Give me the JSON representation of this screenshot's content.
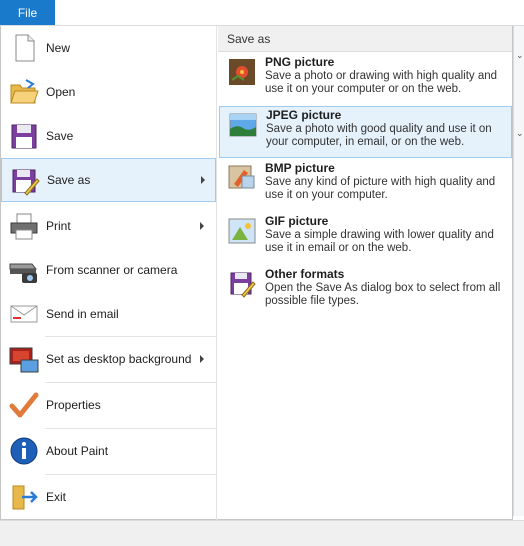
{
  "ribbon": {
    "file_tab": "File"
  },
  "menu": {
    "items": [
      {
        "label": "New"
      },
      {
        "label": "Open"
      },
      {
        "label": "Save"
      },
      {
        "label": "Save as"
      },
      {
        "label": "Print"
      },
      {
        "label": "From scanner or camera"
      },
      {
        "label": "Send in email"
      },
      {
        "label": "Set as desktop background"
      },
      {
        "label": "Properties"
      },
      {
        "label": "About Paint"
      },
      {
        "label": "Exit"
      }
    ]
  },
  "saveas": {
    "header": "Save as",
    "options": [
      {
        "title": "PNG picture",
        "desc": "Save a photo or drawing with high quality and use it on your computer or on the web."
      },
      {
        "title": "JPEG picture",
        "desc": "Save a photo with good quality and use it on your computer, in email, or on the web."
      },
      {
        "title": "BMP picture",
        "desc": "Save any kind of picture with high quality and use it on your computer."
      },
      {
        "title": "GIF picture",
        "desc": "Save a simple drawing with lower quality and use it in email or on the web."
      },
      {
        "title": "Other formats",
        "desc": "Open the Save As dialog box to select from all possible file types."
      }
    ]
  },
  "colors": {
    "accent": "#1979ca",
    "hover": "#e5f1fb",
    "hover_border": "#9fcbee"
  }
}
